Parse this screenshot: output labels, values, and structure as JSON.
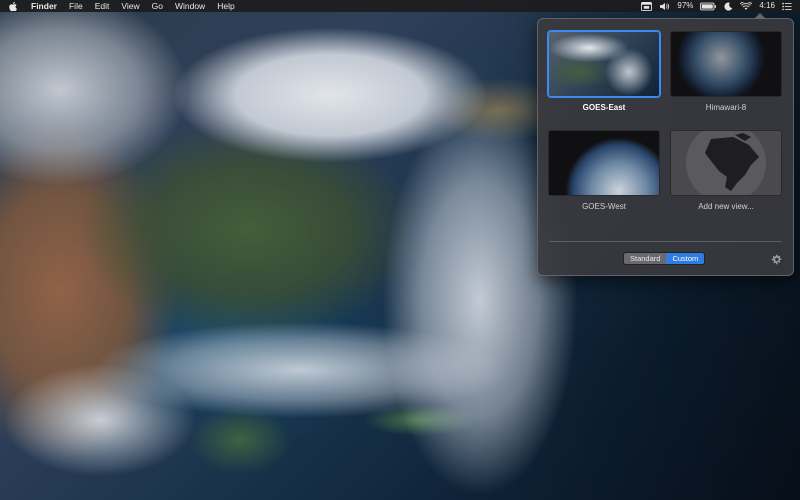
{
  "menubar": {
    "app_name": "Finder",
    "items": [
      "File",
      "Edit",
      "View",
      "Go",
      "Window",
      "Help"
    ],
    "status": {
      "battery_percent": "97%",
      "clock": "4:16"
    }
  },
  "panel": {
    "tiles": [
      {
        "label": "GOES-East",
        "selected": true
      },
      {
        "label": "Himawari-8",
        "selected": false
      },
      {
        "label": "GOES-West",
        "selected": false
      },
      {
        "label": "Add new view...",
        "selected": false
      }
    ],
    "mode_toggle": {
      "options": [
        "Standard",
        "Custom"
      ],
      "selected": "Custom"
    }
  },
  "icons": {
    "apple": "apple-logo-icon",
    "settings": "gear-icon",
    "status": [
      "calendar-badge-icon",
      "volume-icon",
      "battery-icon",
      "dnd-moon-icon",
      "wifi-icon",
      "control-list-icon"
    ]
  },
  "colors": {
    "accent": "#2f7de0",
    "selection_border": "#3d8bf2",
    "panel_bg": "#3a3a3e"
  }
}
